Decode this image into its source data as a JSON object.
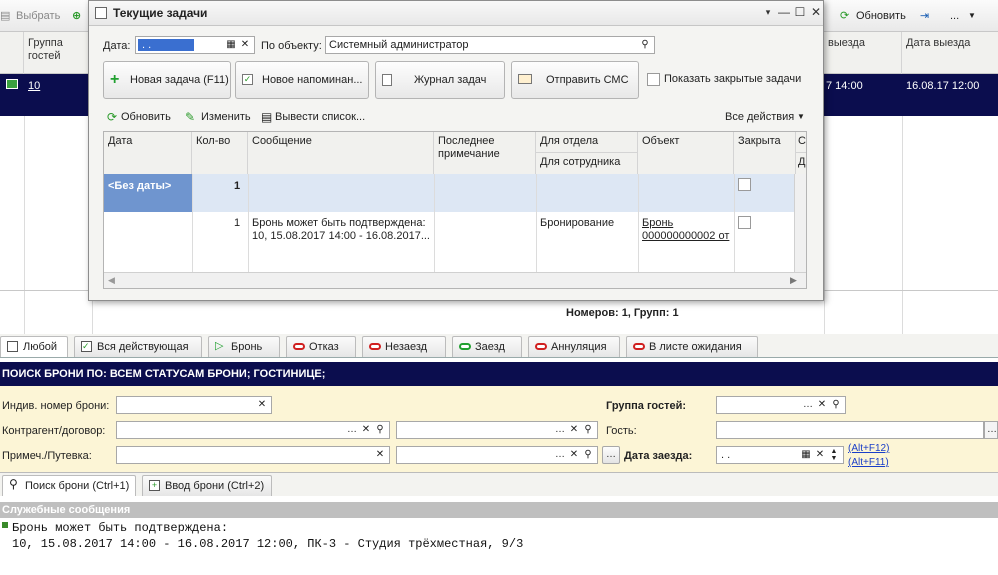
{
  "bg_toolbar": {
    "select_label": "Выбрать",
    "refresh_label": "Обновить",
    "more_label": "..."
  },
  "bg_table": {
    "col_group": "Группа гостей",
    "col_checkout_partial": "выезда",
    "col_checkout": "Дата выезда",
    "row_group_value": "10",
    "row_checkin_partial": "7 14:00",
    "row_checkout_value": "16.08.17 12:00",
    "totals": "Номеров: 1, Групп: 1"
  },
  "status_tabs": [
    {
      "label": "Любой"
    },
    {
      "label": "Вся действующая"
    },
    {
      "label": "Бронь"
    },
    {
      "label": "Отказ"
    },
    {
      "label": "Незаезд"
    },
    {
      "label": "Заезд"
    },
    {
      "label": "Аннуляция"
    },
    {
      "label": "В листе ожидания"
    }
  ],
  "search": {
    "header": "ПОИСК БРОНИ ПО: ВСЕМ СТАТУСАМ БРОНИ; ГОСТИНИЦЕ;",
    "individual_number_label": "Индив. номер брони:",
    "contractor_label": "Контрагент/договор:",
    "note_label": "Примеч./Путевка:",
    "guest_group_label": "Группа гостей:",
    "guest_label": "Гость:",
    "checkin_date_label": "Дата заезда:",
    "checkin_date_value": " .  .",
    "hotkey1": "(Alt+F12)",
    "hotkey2": "(Alt+F11)"
  },
  "bottom_tabs": [
    {
      "label": "Поиск брони (Ctrl+1)"
    },
    {
      "label": "Ввод брони (Ctrl+2)"
    }
  ],
  "messages": {
    "header": "Служебные сообщения",
    "line1": "Бронь может быть подтверждена:",
    "line2": "10, 15.08.2017 14:00 - 16.08.2017 12:00, ПК-3 - Студия трёхместная, 9/3"
  },
  "dialog": {
    "title": "Текущие задачи",
    "date_label": "Дата:",
    "date_value": " .  .",
    "object_label": "По объекту:",
    "object_value": "Системный администратор",
    "btn_new_task": "Новая задача (F11)",
    "btn_new_reminder": "Новое напоминан...",
    "btn_journal": "Журнал задач",
    "btn_sms": "Отправить СМС",
    "show_closed_label": "Показать закрытые задачи",
    "cmd_refresh": "Обновить",
    "cmd_edit": "Изменить",
    "cmd_list": "Вывести список...",
    "cmd_all_actions": "Все действия",
    "columns": {
      "date": "Дата",
      "qty": "Кол-во",
      "message": "Сообщение",
      "last_note": "Последнее примечание",
      "for_department": "Для отдела",
      "for_employee": "Для сотрудника",
      "object": "Объект",
      "closed": "Закрыта",
      "extra1": "С",
      "extra2": "Д"
    },
    "rows": [
      {
        "date": "<Без даты>",
        "qty": "1",
        "message": "",
        "department": "",
        "object": ""
      },
      {
        "date": "",
        "qty": "1",
        "message_line1": "Бронь может быть подтверждена:",
        "message_line2": "10, 15.08.2017 14:00 - 16.08.2017...",
        "department": "Бронирование",
        "object_line1": "Бронь",
        "object_line2": "000000000002 от"
      }
    ]
  }
}
